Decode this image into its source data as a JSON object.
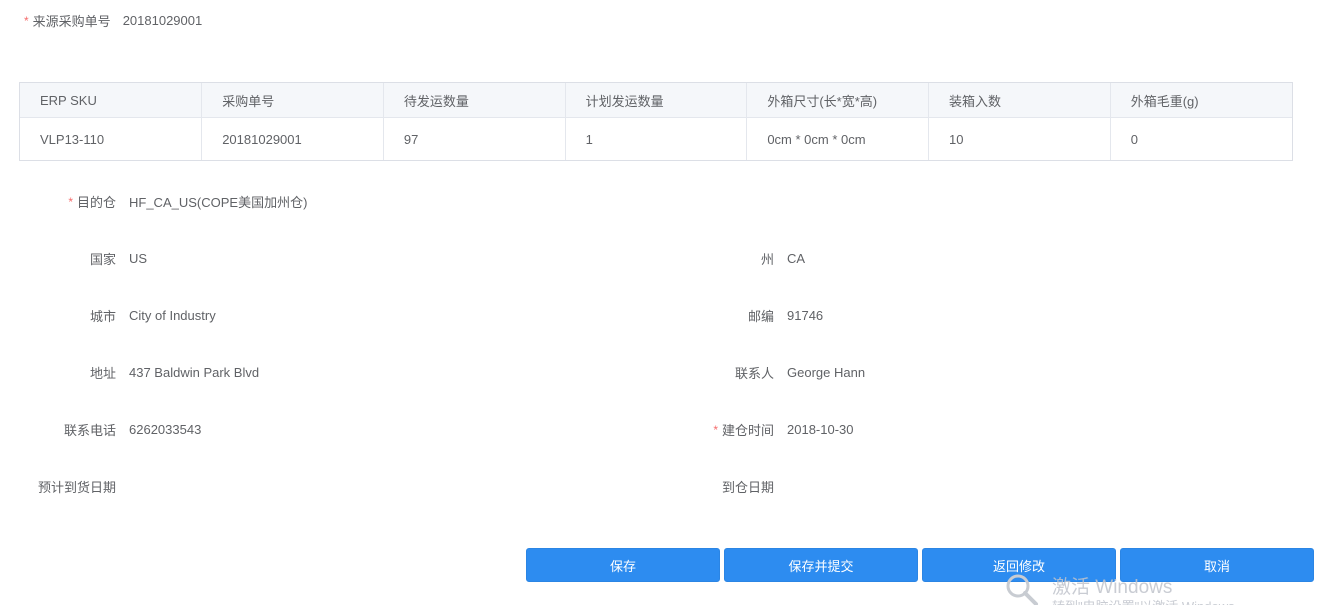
{
  "header": {
    "source_po_label": "来源采购单号",
    "source_po_value": "20181029001"
  },
  "table": {
    "columns": [
      "ERP SKU",
      "采购单号",
      "待发运数量",
      "计划发运数量",
      "外箱尺寸(长*宽*高)",
      "装箱入数",
      "外箱毛重(g)"
    ],
    "rows": [
      [
        "VLP13-110",
        "20181029001",
        "97",
        "1",
        "0cm * 0cm * 0cm",
        "10",
        "0"
      ]
    ]
  },
  "form": {
    "warehouse_label": "目的仓",
    "warehouse_value": "HF_CA_US(COPE美国加州仓)",
    "country_label": "国家",
    "country_value": "US",
    "state_label": "州",
    "state_value": "CA",
    "city_label": "城市",
    "city_value": "City of Industry",
    "zip_label": "邮编",
    "zip_value": "91746",
    "address_label": "地址",
    "address_value": "437 Baldwin Park Blvd",
    "contact_label": "联系人",
    "contact_value": "George Hann",
    "phone_label": "联系电话",
    "phone_value": "6262033543",
    "created_label": "建仓时间",
    "created_value": "2018-10-30",
    "eta_label": "预计到货日期",
    "eta_value": "",
    "arrival_label": "到仓日期",
    "arrival_value": "",
    "required_mark": "*"
  },
  "actions": {
    "save": "保存",
    "save_submit": "保存并提交",
    "back_edit": "返回修改",
    "cancel": "取消"
  },
  "watermark": {
    "title": "激活 Windows",
    "subtitle": "转到\"电脑设置\"以激活 Windows。"
  },
  "colors": {
    "primary": "#2d8cf0",
    "required": "#f56c6c",
    "text": "#606266",
    "header_bg": "#f5f7fa",
    "border": "#dcdfe6"
  }
}
